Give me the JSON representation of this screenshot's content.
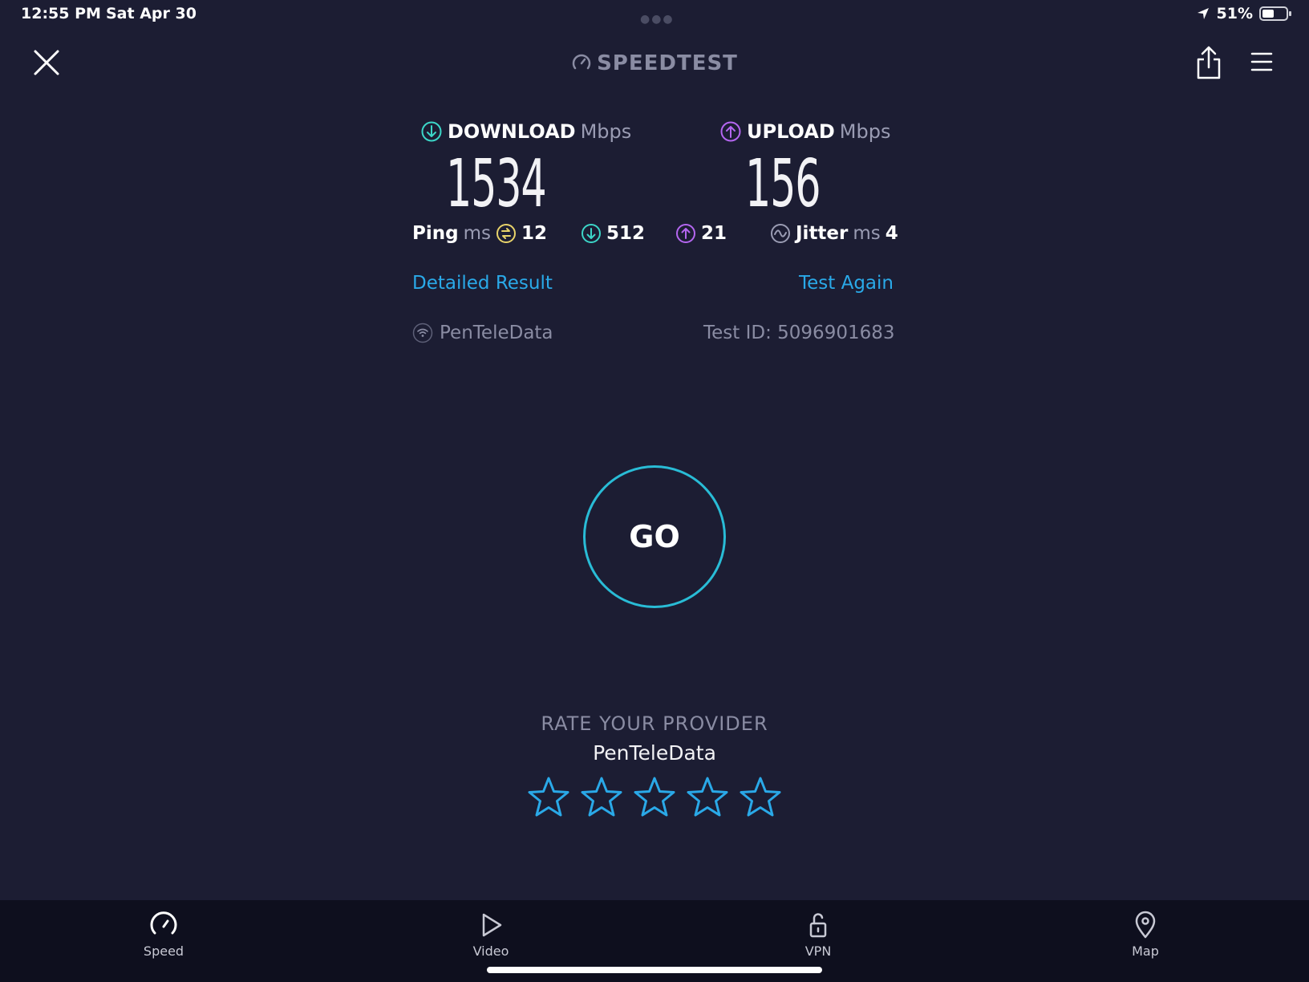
{
  "status_bar": {
    "time": "12:55 PM",
    "date": "Sat Apr 30",
    "battery_percent": "51%",
    "battery_level": 0.51
  },
  "header": {
    "brand": "SPEEDTEST"
  },
  "download": {
    "label": "DOWNLOAD",
    "unit": "Mbps",
    "value": "1534"
  },
  "upload": {
    "label": "UPLOAD",
    "unit": "Mbps",
    "value": "156"
  },
  "ping": {
    "label": "Ping",
    "unit": "ms",
    "idle": "12",
    "download": "512",
    "upload": "21"
  },
  "jitter": {
    "label": "Jitter",
    "unit": "ms",
    "value": "4"
  },
  "links": {
    "detailed": "Detailed Result",
    "again": "Test Again"
  },
  "provider": {
    "name": "PenTeleData",
    "test_id": "Test ID: 5096901683"
  },
  "go_label": "GO",
  "rating": {
    "title": "RATE YOUR PROVIDER",
    "provider": "PenTeleData",
    "stars_total": 5,
    "stars_filled": 0
  },
  "tabs": [
    {
      "label": "Speed",
      "icon": "speed-gauge-icon"
    },
    {
      "label": "Video",
      "icon": "play-icon"
    },
    {
      "label": "VPN",
      "icon": "lock-icon"
    },
    {
      "label": "Map",
      "icon": "map-pin-icon"
    }
  ],
  "colors": {
    "background": "#1c1d33",
    "download": "#3cd6c8",
    "upload": "#b466f0",
    "ping_idle": "#e8d36a",
    "link": "#2aa9e8",
    "go_ring": "#29bcd6",
    "star": "#2aa9e8"
  }
}
